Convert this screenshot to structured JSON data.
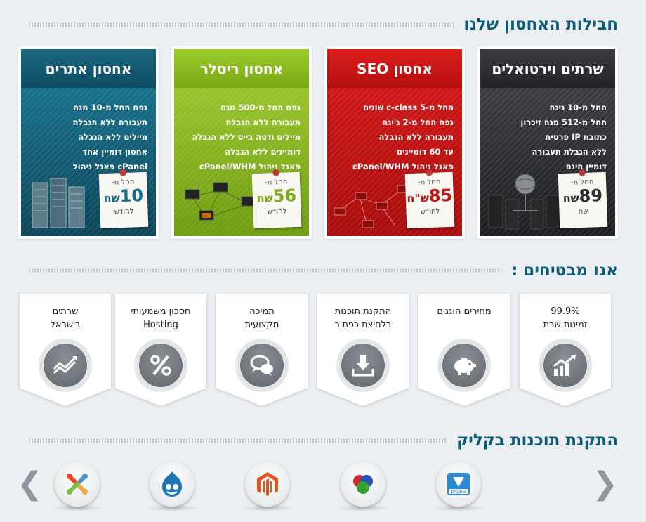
{
  "sections": {
    "plans_title": "חבילות האחסון שלנו",
    "promise_title": "אנו מבטיחים :",
    "apps_title": "התקנת תוכנות בקליק"
  },
  "plans": [
    {
      "title": "שרתים וירטואלים",
      "features": [
        "החל מ-10 גיגה",
        "החל מ-512 מגה זיכרון",
        "כתובת IP פרטית",
        "ללא הגבלת תעבורה",
        "דומיין חינם"
      ],
      "from": "החל מ-",
      "price": "89",
      "currency": "שח",
      "period": "שח"
    },
    {
      "title": "אחסון SEO",
      "features": [
        "החל מ-5 c-class שונים",
        "נפח החל מ-2 ג'יגה",
        "תעבורה ללא הגבלה",
        "עד 60 דומיינים",
        "פאנל ניהול cPanel/WHM"
      ],
      "from": "החל מ-",
      "price": "85",
      "currency": "ש\"ח",
      "period": "לחודש"
    },
    {
      "title": "אחסון ריסלר",
      "features": [
        "נפח החל מ-500 מגה",
        "תעבורה ללא הגבלה",
        "מיילים ודטה בייס ללא הגבלה",
        "דומיינים ללא הגבלה",
        "פאנל ניהול cPanel/WHM"
      ],
      "from": "החל מ-",
      "price": "56",
      "currency": "שח",
      "period": "לחודש"
    },
    {
      "title": "אחסון אתרים",
      "features": [
        "נפח החל מ-10 מגה",
        "תעבורה ללא הגבלה",
        "מיילים ללא הגבלה",
        "אחסון דומיין אחד",
        "cPanel פאנל ניהול"
      ],
      "from": "החל מ-",
      "price": "10",
      "currency": "שח",
      "period": "לחודש"
    }
  ],
  "promises": [
    {
      "line1": "99.9%",
      "line2": "זמינות שרת",
      "icon": "chart-up-icon"
    },
    {
      "line1": "מחירים הוגנים",
      "line2": "",
      "icon": "piggy-bank-icon"
    },
    {
      "line1": "התקנת תוכנות",
      "line2": "בלחיצת כפתור",
      "icon": "download-icon"
    },
    {
      "line1": "תמיכה",
      "line2": "מקצועית",
      "icon": "chat-bubbles-icon"
    },
    {
      "line1": "חסכון משמעותי",
      "line2": "Hosting",
      "icon": "percent-icon"
    },
    {
      "line1": "שרתים",
      "line2": "בישראל",
      "icon": "trend-icon"
    }
  ],
  "apps": [
    {
      "name": "phpbb-icon",
      "label": "phpBB"
    },
    {
      "name": "spheres-icon",
      "label": ""
    },
    {
      "name": "magento-icon",
      "label": ""
    },
    {
      "name": "drupal-icon",
      "label": ""
    },
    {
      "name": "joomla-icon",
      "label": ""
    }
  ],
  "colors": {
    "accent": "#0b5a78",
    "virtual": "#2e3034",
    "seo": "#c81414",
    "reseller": "#8cbb20",
    "sites": "#145f7a"
  }
}
